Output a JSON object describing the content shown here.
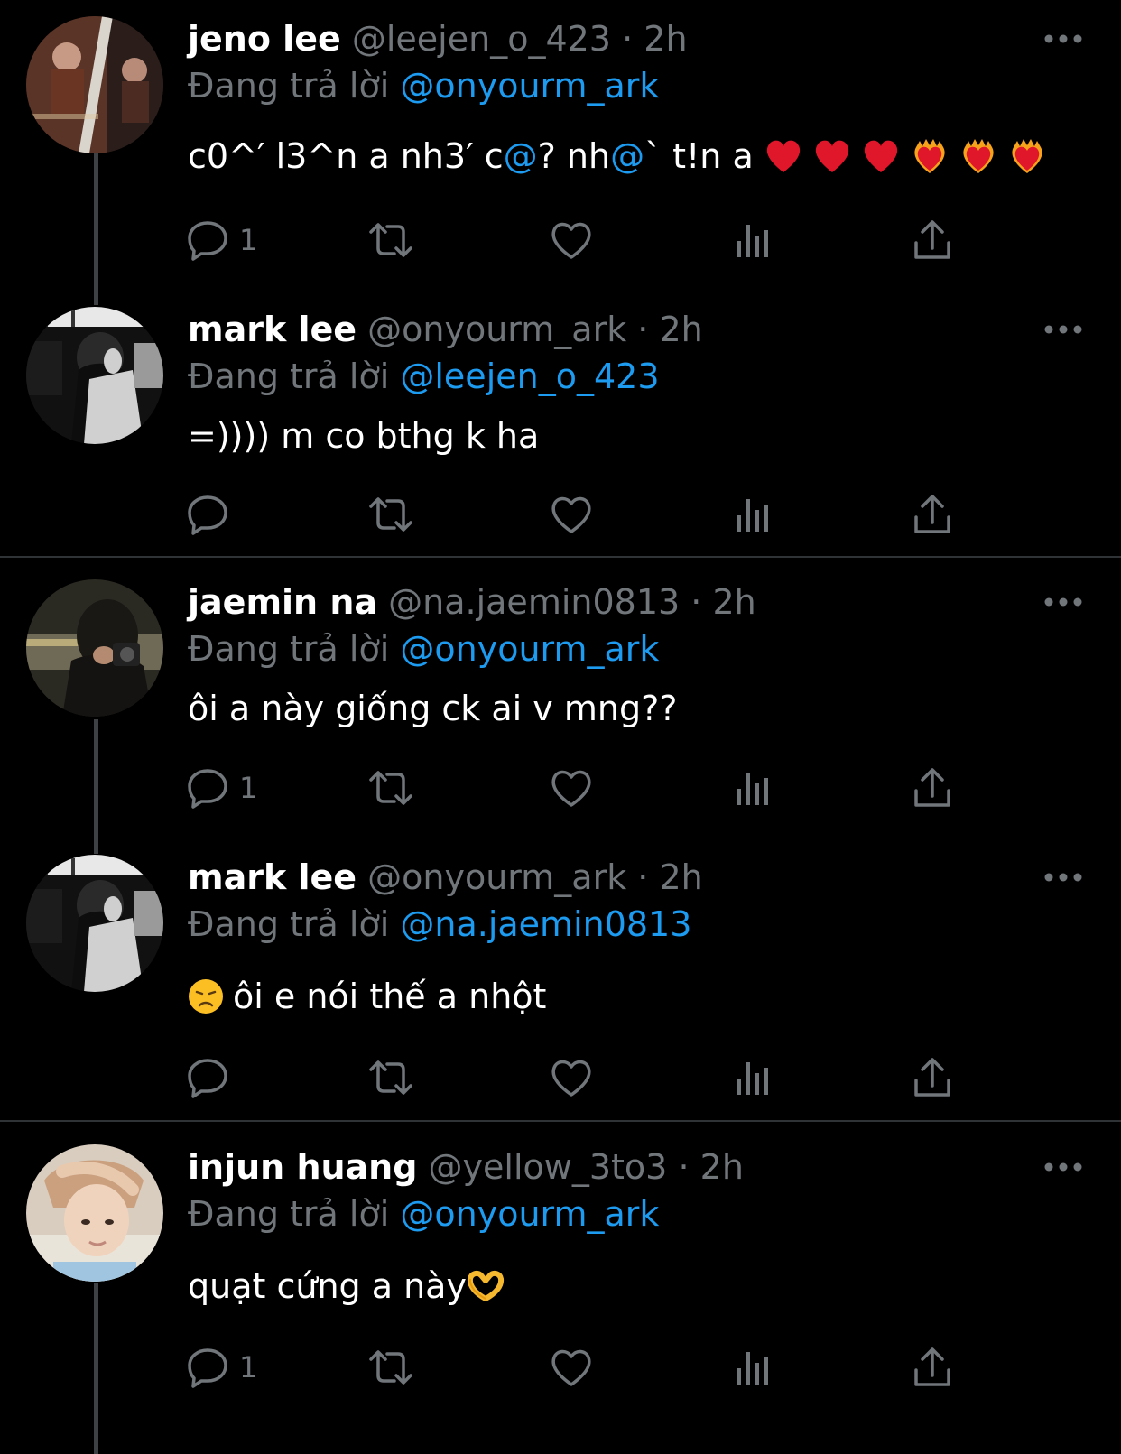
{
  "theme": {
    "background": "#000000",
    "text": "#ffffff",
    "muted": "#71767b",
    "link": "#1d9bf0",
    "divider": "#2f3336",
    "thread_line": "#3e4144"
  },
  "reply_prefix": "Đang trả lời",
  "tweets": [
    {
      "display_name": "jeno lee",
      "handle": "@leejen_o_423",
      "dot": "·",
      "time": "2h",
      "reply_to": "@onyourm_ark",
      "text": "c0^′ l3^n a nh3′ c",
      "text_parts": [
        "c0^′ l3^n a nh3′ c",
        "@",
        "? nh",
        "@",
        "` t!n a"
      ],
      "emojis": [
        "red-heart",
        "red-heart",
        "red-heart",
        "heart-on-fire",
        "heart-on-fire",
        "heart-on-fire"
      ],
      "reply_count": "1",
      "avatar": "avatar-film-strip"
    },
    {
      "display_name": "mark lee",
      "handle": "@onyourm_ark",
      "dot": "·",
      "time": "2h",
      "reply_to": "@leejen_o_423",
      "text": "=)))) m co bthg k ha",
      "reply_count": "",
      "avatar": "avatar-bw-portrait"
    },
    {
      "display_name": "jaemin na",
      "handle": "@na.jaemin0813",
      "dot": "·",
      "time": "2h",
      "reply_to": "@onyourm_ark",
      "text": "ôi a này giống ck ai v mng??",
      "reply_count": "1",
      "avatar": "avatar-camera-night"
    },
    {
      "display_name": "mark lee",
      "handle": "@onyourm_ark",
      "dot": "·",
      "time": "2h",
      "reply_to": "@na.jaemin0813",
      "text": "ôi e nói thế a nhột",
      "emoji": "disappointed-face",
      "reply_count": "",
      "avatar": "avatar-bw-portrait"
    },
    {
      "display_name": "injun huang",
      "handle": "@yellow_3to3",
      "dot": "·",
      "time": "2h",
      "reply_to": "@onyourm_ark",
      "text": "quạt cứng a này",
      "emoji": "heart-hands",
      "reply_count": "1",
      "avatar": "avatar-soft-portrait"
    }
  ],
  "action_icons": [
    "reply-icon",
    "retweet-icon",
    "like-icon",
    "views-icon",
    "share-icon"
  ]
}
